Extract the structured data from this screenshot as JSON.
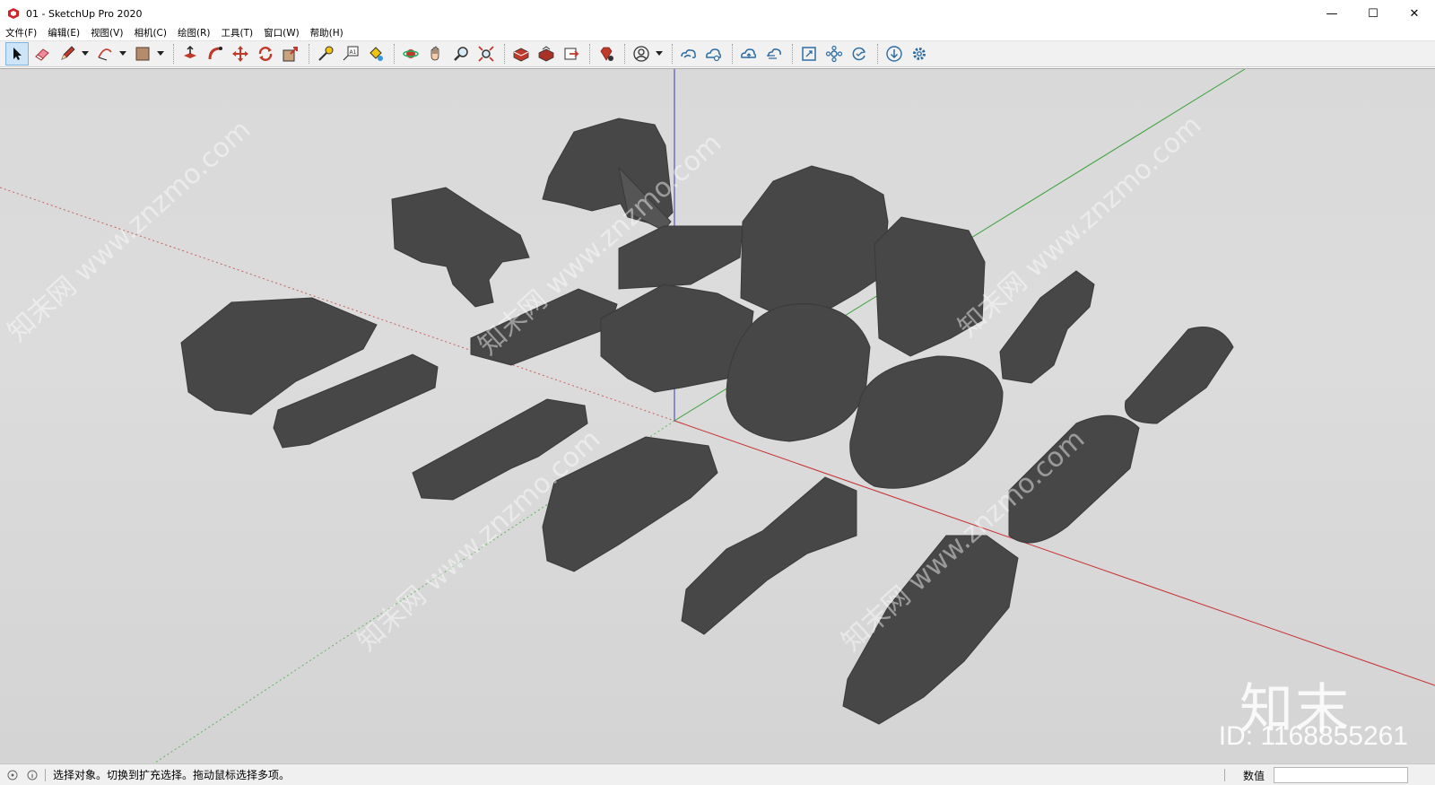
{
  "window": {
    "title": "01 - SketchUp Pro 2020",
    "controls": {
      "minimize": "—",
      "maximize": "☐",
      "close": "✕"
    }
  },
  "menu": [
    {
      "label": "文件(F)"
    },
    {
      "label": "编辑(E)"
    },
    {
      "label": "视图(V)"
    },
    {
      "label": "相机(C)"
    },
    {
      "label": "绘图(R)"
    },
    {
      "label": "工具(T)"
    },
    {
      "label": "窗口(W)"
    },
    {
      "label": "帮助(H)"
    }
  ],
  "toolbar": {
    "tools": [
      "select-icon",
      "eraser-icon",
      "pencil-icon",
      "arc-icon",
      "rectangle-icon",
      "push-pull-icon",
      "follow-me-icon",
      "move-icon",
      "rotate-icon",
      "scale-icon",
      "tape-measure-icon",
      "text-icon",
      "paint-bucket-icon",
      "orbit-icon",
      "pan-icon",
      "zoom-icon",
      "zoom-extents-icon",
      "warehouse-icon",
      "extension-warehouse-icon",
      "send-to-layout-icon",
      "ruby-console-icon",
      "account-icon",
      "trimble-connect-icon",
      "collaborate-icon",
      "upload-icon",
      "sync-icon",
      "frame-icon",
      "component-icon",
      "refresh-icon",
      "download-icon",
      "settings-icon"
    ],
    "active_tool": "select-icon"
  },
  "viewport": {
    "background": "#d9d9d9",
    "axis_colors": {
      "red": "#c73030",
      "green": "#3aa23a",
      "blue": "#3a3ab8"
    },
    "model_color": "#454545",
    "watermark_logo": "知末",
    "watermark_id": "ID: 1168855261",
    "watermark_text": "知末网 www.znzmo.com"
  },
  "status": {
    "message": "选择对象。切换到扩充选择。拖动鼠标选择多项。",
    "measurements_label": "数值",
    "measurements_value": ""
  }
}
